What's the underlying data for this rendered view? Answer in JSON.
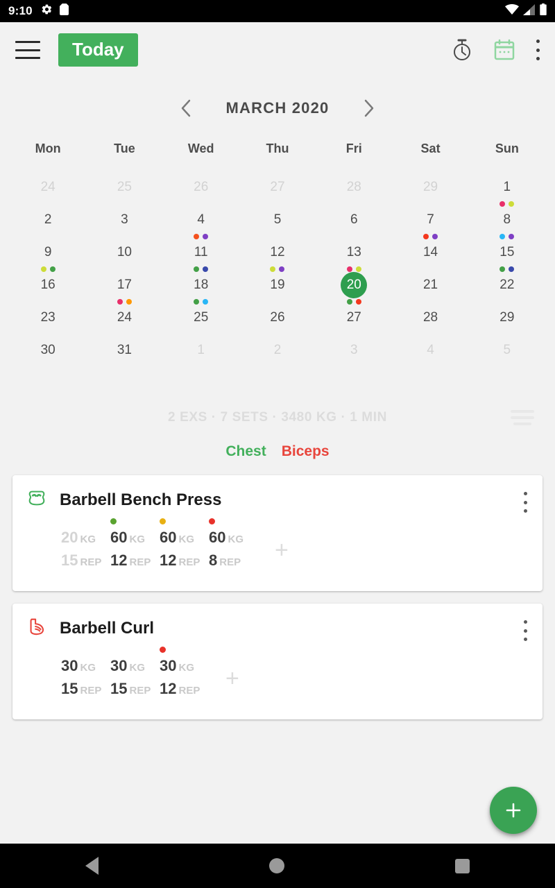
{
  "status_bar": {
    "time": "9:10",
    "left_icons": [
      "gear-icon",
      "sd-card-icon"
    ],
    "right_icons": [
      "wifi-icon",
      "cellular-signal-icon",
      "battery-icon"
    ]
  },
  "app_bar": {
    "menu_icon": "hamburger-menu-icon",
    "today_label": "Today",
    "today_bg": "#43b05c",
    "timer_icon": "stopwatch-icon",
    "calendar_icon": "calendar-icon",
    "overflow_icon": "kebab-menu-icon"
  },
  "calendar": {
    "prev_icon": "chevron-left-icon",
    "next_icon": "chevron-right-icon",
    "month_label": "MARCH 2020",
    "weekdays": [
      "Mon",
      "Tue",
      "Wed",
      "Thu",
      "Fri",
      "Sat",
      "Sun"
    ],
    "selected_day": "20",
    "selected_bg": "#2e9e4f",
    "weeks": [
      [
        {
          "day": "24",
          "muted": true,
          "dots": []
        },
        {
          "day": "25",
          "muted": true,
          "dots": []
        },
        {
          "day": "26",
          "muted": true,
          "dots": []
        },
        {
          "day": "27",
          "muted": true,
          "dots": []
        },
        {
          "day": "28",
          "muted": true,
          "dots": []
        },
        {
          "day": "29",
          "muted": true,
          "dots": []
        },
        {
          "day": "1",
          "muted": false,
          "dots": [
            "#e8306a",
            "#cddc39"
          ]
        }
      ],
      [
        {
          "day": "2",
          "muted": false,
          "dots": []
        },
        {
          "day": "3",
          "muted": false,
          "dots": []
        },
        {
          "day": "4",
          "muted": false,
          "dots": [
            "#f4511e",
            "#7e3fc4"
          ]
        },
        {
          "day": "5",
          "muted": false,
          "dots": []
        },
        {
          "day": "6",
          "muted": false,
          "dots": []
        },
        {
          "day": "7",
          "muted": false,
          "dots": [
            "#f4381e",
            "#7e3fc4"
          ]
        },
        {
          "day": "8",
          "muted": false,
          "dots": [
            "#29b6f6",
            "#7e3fc4"
          ]
        }
      ],
      [
        {
          "day": "9",
          "muted": false,
          "dots": [
            "#cddc39",
            "#43a047"
          ]
        },
        {
          "day": "10",
          "muted": false,
          "dots": []
        },
        {
          "day": "11",
          "muted": false,
          "dots": [
            "#43a047",
            "#3949ab"
          ]
        },
        {
          "day": "12",
          "muted": false,
          "dots": [
            "#cddc39",
            "#7e3fc4"
          ]
        },
        {
          "day": "13",
          "muted": false,
          "dots": [
            "#e8306a",
            "#cddc39"
          ]
        },
        {
          "day": "14",
          "muted": false,
          "dots": []
        },
        {
          "day": "15",
          "muted": false,
          "dots": [
            "#43a047",
            "#3949ab"
          ]
        }
      ],
      [
        {
          "day": "16",
          "muted": false,
          "dots": []
        },
        {
          "day": "17",
          "muted": false,
          "dots": [
            "#e8306a",
            "#ff9800"
          ]
        },
        {
          "day": "18",
          "muted": false,
          "dots": [
            "#43a047",
            "#29b6f6"
          ]
        },
        {
          "day": "19",
          "muted": false,
          "dots": []
        },
        {
          "day": "20",
          "muted": false,
          "dots": [
            "#43a047",
            "#f4381e"
          ],
          "selected": true
        },
        {
          "day": "21",
          "muted": false,
          "dots": []
        },
        {
          "day": "22",
          "muted": false,
          "dots": []
        }
      ],
      [
        {
          "day": "23",
          "muted": false,
          "dots": []
        },
        {
          "day": "24",
          "muted": false,
          "dots": []
        },
        {
          "day": "25",
          "muted": false,
          "dots": []
        },
        {
          "day": "26",
          "muted": false,
          "dots": []
        },
        {
          "day": "27",
          "muted": false,
          "dots": []
        },
        {
          "day": "28",
          "muted": false,
          "dots": []
        },
        {
          "day": "29",
          "muted": false,
          "dots": []
        }
      ],
      [
        {
          "day": "30",
          "muted": false,
          "dots": []
        },
        {
          "day": "31",
          "muted": false,
          "dots": []
        },
        {
          "day": "1",
          "muted": true,
          "dots": []
        },
        {
          "day": "2",
          "muted": true,
          "dots": []
        },
        {
          "day": "3",
          "muted": true,
          "dots": []
        },
        {
          "day": "4",
          "muted": true,
          "dots": []
        },
        {
          "day": "5",
          "muted": true,
          "dots": []
        }
      ]
    ]
  },
  "workout_summary": {
    "text": "2 EXS · 7 SETS · 3480 KG · 1 MIN",
    "exercises_count": "2 EXS",
    "sets_count": "7 SETS",
    "volume": "3480 KG",
    "duration": "1 MIN",
    "list_icon": "list-lines-icon"
  },
  "muscle_tabs": [
    {
      "label": "Chest",
      "color": "#43b05c"
    },
    {
      "label": "Biceps",
      "color": "#e8453c"
    }
  ],
  "exercises": [
    {
      "icon": "chest-muscle-icon",
      "icon_color": "#43b05c",
      "name": "Barbell Bench Press",
      "menu_icon": "kebab-menu-icon",
      "add_set_label": "+",
      "sets": [
        {
          "weight": "20",
          "weight_unit": "KG",
          "reps": "15",
          "reps_unit": "REP",
          "dot": null,
          "faded": true
        },
        {
          "weight": "60",
          "weight_unit": "KG",
          "reps": "12",
          "reps_unit": "REP",
          "dot": "#5aa330",
          "faded": false
        },
        {
          "weight": "60",
          "weight_unit": "KG",
          "reps": "12",
          "reps_unit": "REP",
          "dot": "#e8b013",
          "faded": false
        },
        {
          "weight": "60",
          "weight_unit": "KG",
          "reps": "8",
          "reps_unit": "REP",
          "dot": "#e8322a",
          "faded": false
        }
      ]
    },
    {
      "icon": "bicep-muscle-icon",
      "icon_color": "#e8453c",
      "name": "Barbell Curl",
      "menu_icon": "kebab-menu-icon",
      "add_set_label": "+",
      "sets": [
        {
          "weight": "30",
          "weight_unit": "KG",
          "reps": "15",
          "reps_unit": "REP",
          "dot": null,
          "faded": false
        },
        {
          "weight": "30",
          "weight_unit": "KG",
          "reps": "15",
          "reps_unit": "REP",
          "dot": null,
          "faded": false
        },
        {
          "weight": "30",
          "weight_unit": "KG",
          "reps": "12",
          "reps_unit": "REP",
          "dot": "#e8322a",
          "faded": false
        }
      ]
    }
  ],
  "fab": {
    "icon": "plus-icon",
    "color": "#3aa354"
  },
  "nav_bar": {
    "back": "back-triangle-icon",
    "home": "home-circle-icon",
    "recents": "recents-square-icon"
  }
}
